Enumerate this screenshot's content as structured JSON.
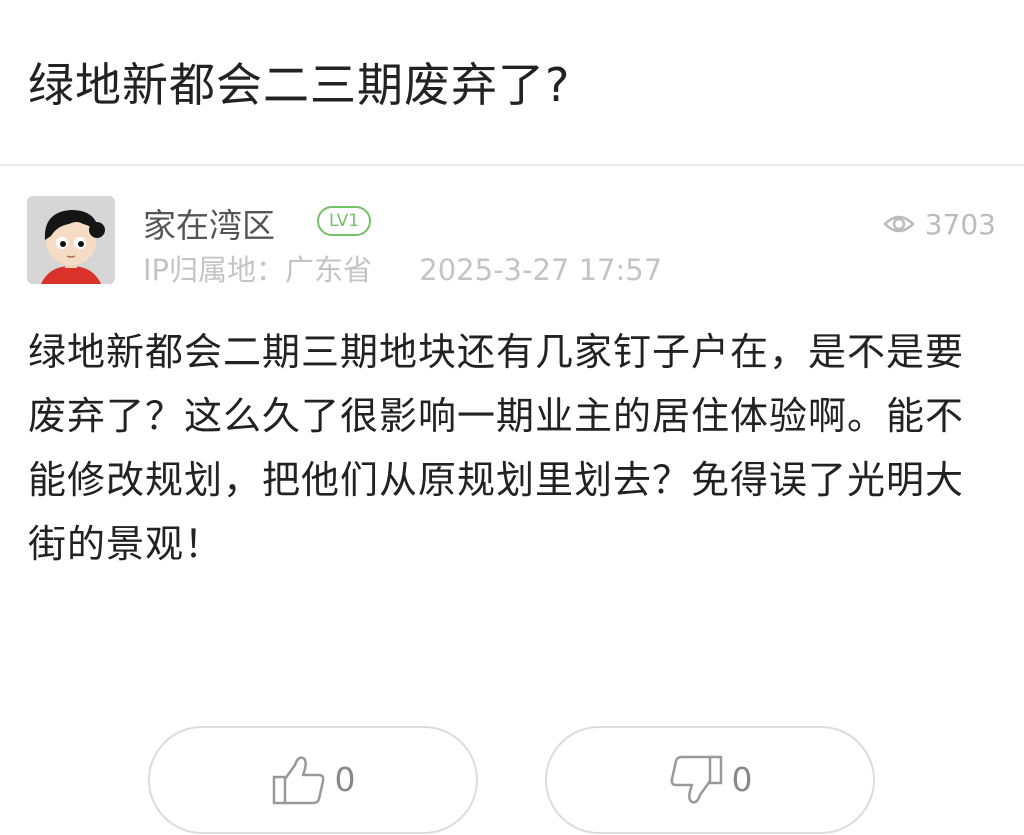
{
  "post": {
    "title": "绿地新都会二三期废弃了?",
    "author": {
      "name": "家在湾区",
      "level": "LV1",
      "avatar_icon": "cartoon-avatar-icon"
    },
    "ip_location": "IP归属地：广东省",
    "date": "2025-3-27 17:57",
    "views": "3703",
    "content": "绿地新都会二期三期地块还有几家钉子户在，是不是要废弃了？这么久了很影响一期业主的居住体验啊。能不能修改规划，把他们从原规划里划去？免得误了光明大街的景观！"
  },
  "actions": {
    "like_count": "0",
    "dislike_count": "0",
    "like_icon": "thumbs-up-icon",
    "dislike_icon": "thumbs-down-icon",
    "view_icon": "eye-icon"
  },
  "colors": {
    "level_badge": "#77c06a",
    "meta_text": "#c4c4c4",
    "border": "#dcdcdc"
  }
}
